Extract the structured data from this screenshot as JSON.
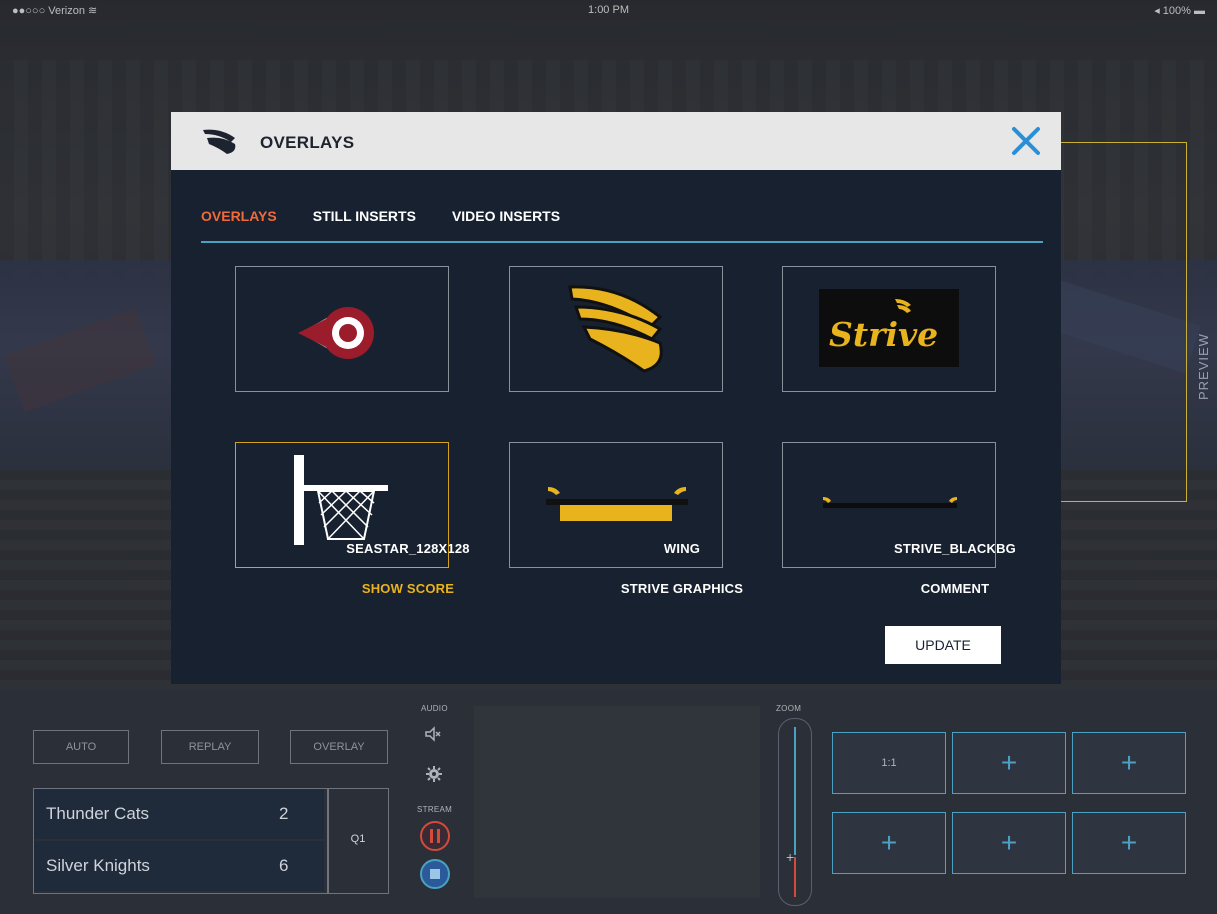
{
  "status_bar": {
    "carrier": "●●○○○ Verizon ≋",
    "time": "1:00 PM",
    "battery": "◂ 100% ▬"
  },
  "preview_label": "PREVIEW",
  "modal": {
    "title": "OVERLAYS",
    "tabs": [
      {
        "label": "OVERLAYS",
        "active": true
      },
      {
        "label": "STILL INSERTS",
        "active": false
      },
      {
        "label": "VIDEO INSERTS",
        "active": false
      }
    ],
    "tiles": [
      {
        "label": "SEASTAR_128X128",
        "icon": "seastar-icon",
        "selected": false
      },
      {
        "label": "WING",
        "icon": "wing-icon",
        "selected": false
      },
      {
        "label": "STRIVE_BLACKBG",
        "icon": "strive-logo",
        "selected": false
      },
      {
        "label": "SHOW SCORE",
        "icon": "basketball-hoop-icon",
        "selected": true
      },
      {
        "label": "STRIVE GRAPHICS",
        "icon": "lower-third-bar-icon",
        "selected": false
      },
      {
        "label": "COMMENT",
        "icon": "thin-bar-icon",
        "selected": false
      }
    ],
    "strive_text": "Strive",
    "update_label": "UPDATE"
  },
  "panel": {
    "buttons": {
      "auto": "AUTO",
      "replay": "REPLAY",
      "overlay": "OVERLAY"
    },
    "audio_label": "AUDIO",
    "stream_label": "STREAM",
    "zoom_label": "ZOOM",
    "zoom_handle": "+",
    "teams": [
      {
        "name": "Thunder Cats",
        "score": "2"
      },
      {
        "name": "Silver Knights",
        "score": "6"
      }
    ],
    "quarter": "Q1",
    "presets": [
      "1:1",
      "+",
      "+",
      "+",
      "+",
      "+"
    ]
  },
  "colors": {
    "accent_orange": "#f06a3a",
    "accent_blue": "#4aa1c2",
    "selected_gold": "#e8b31d",
    "modal_bg": "#172130"
  }
}
